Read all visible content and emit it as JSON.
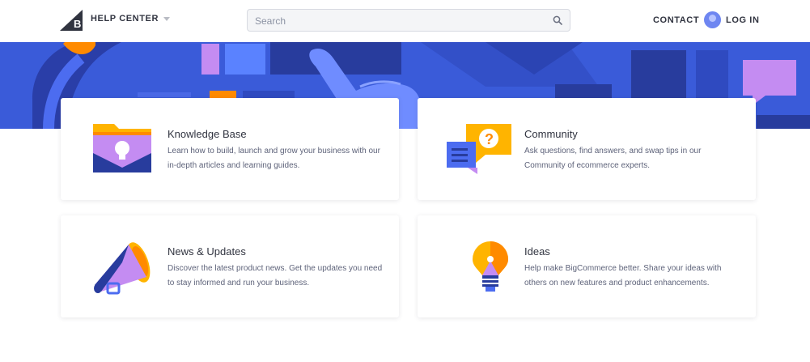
{
  "header": {
    "brand": "HELP CENTER",
    "search": {
      "placeholder": "Search",
      "value": ""
    },
    "contact_label": "CONTACT",
    "login_label": "LOG IN"
  },
  "cards": [
    {
      "title": "Knowledge Base",
      "description": "Learn how to build, launch and grow your business with our in-depth articles and learning guides.",
      "icon": "folder-lightbulb-icon"
    },
    {
      "title": "Community",
      "description": "Ask questions, find answers, and swap tips in our Community of ecommerce experts.",
      "icon": "chat-question-icon"
    },
    {
      "title": "News & Updates",
      "description": "Discover the latest product news. Get the updates you need to stay informed and run your business.",
      "icon": "megaphone-icon"
    },
    {
      "title": "Ideas",
      "description": "Help make BigCommerce better. Share your ideas with others on new features and product enhancements.",
      "icon": "lightbulb-icon"
    }
  ],
  "colors": {
    "hero_blue": "#3a5bd9",
    "accent_purple": "#c48cf2",
    "accent_yellow": "#ffb400",
    "accent_orange": "#ff8a00",
    "navy": "#283c9d",
    "text_dark": "#313440",
    "text_muted": "#5e637a"
  }
}
